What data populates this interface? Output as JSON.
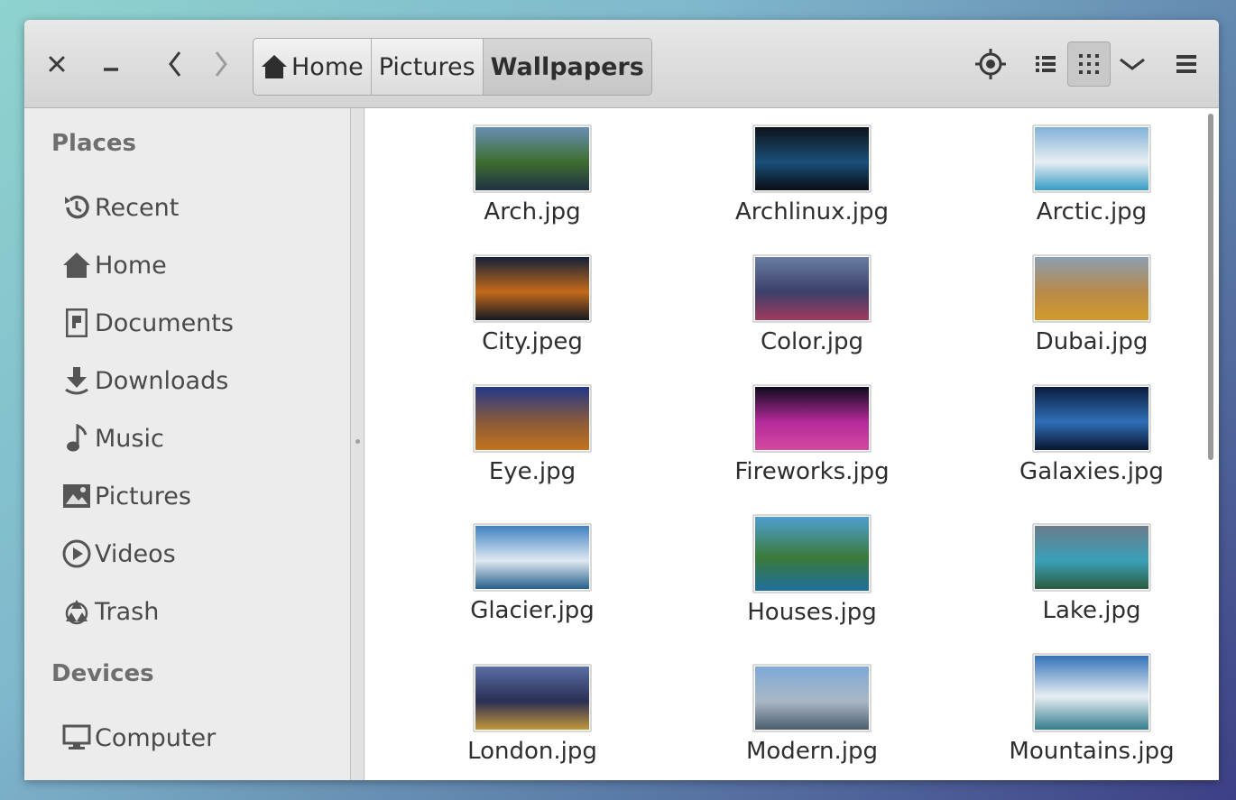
{
  "window": {
    "controls": {
      "close_icon": "close-icon",
      "minimize_icon": "minimize-icon"
    },
    "nav": {
      "back_icon": "chevron-left-icon",
      "forward_icon": "chevron-right-icon"
    },
    "breadcrumbs": [
      {
        "label": "Home",
        "icon": "home-icon"
      },
      {
        "label": "Pictures"
      },
      {
        "label": "Wallpapers",
        "active": true
      }
    ],
    "toolbar": {
      "location_icon": "crosshair-icon",
      "list_view_icon": "list-view-icon",
      "grid_view_icon": "grid-view-icon",
      "view_options_icon": "chevron-down-icon",
      "menu_icon": "hamburger-menu-icon"
    }
  },
  "sidebar": {
    "places_title": "Places",
    "places": [
      {
        "label": "Recent",
        "icon": "recent-icon"
      },
      {
        "label": "Home",
        "icon": "home-icon"
      },
      {
        "label": "Documents",
        "icon": "document-icon"
      },
      {
        "label": "Downloads",
        "icon": "download-icon"
      },
      {
        "label": "Music",
        "icon": "music-note-icon"
      },
      {
        "label": "Pictures",
        "icon": "picture-icon"
      },
      {
        "label": "Videos",
        "icon": "play-icon"
      },
      {
        "label": "Trash",
        "icon": "recycle-icon"
      }
    ],
    "devices_title": "Devices",
    "devices": [
      {
        "label": "Computer",
        "icon": "computer-icon"
      }
    ]
  },
  "files": [
    {
      "name": "Arch.jpg",
      "colors": [
        "#6a8fb8",
        "#3d6e2f",
        "#1e2f44"
      ]
    },
    {
      "name": "Archlinux.jpg",
      "colors": [
        "#0d1117",
        "#1a4f7a",
        "#0a0d12"
      ]
    },
    {
      "name": "Arctic.jpg",
      "colors": [
        "#7fb1d8",
        "#e8eef2",
        "#2f9ac3"
      ]
    },
    {
      "name": "City.jpeg",
      "colors": [
        "#0f1e3a",
        "#c46a1a",
        "#101622"
      ]
    },
    {
      "name": "Color.jpg",
      "colors": [
        "#6b7fa3",
        "#3b3f6a",
        "#a33b5e"
      ]
    },
    {
      "name": "Dubai.jpg",
      "colors": [
        "#8a9fb2",
        "#b78a4a",
        "#d49b2a"
      ]
    },
    {
      "name": "Eye.jpg",
      "colors": [
        "#20378a",
        "#8a5a3a",
        "#c4741c"
      ]
    },
    {
      "name": "Fireworks.jpg",
      "colors": [
        "#0a0a1a",
        "#b42a9a",
        "#d24aa0"
      ]
    },
    {
      "name": "Galaxies.jpg",
      "colors": [
        "#0a1a3a",
        "#2f6fb8",
        "#08132a"
      ]
    },
    {
      "name": "Glacier.jpg",
      "colors": [
        "#3c7fc0",
        "#dfe9f1",
        "#1f5a8a"
      ]
    },
    {
      "name": "Houses.jpg",
      "colors": [
        "#4f9fd4",
        "#3a7a3a",
        "#1f6ea0"
      ]
    },
    {
      "name": "Lake.jpg",
      "colors": [
        "#6c7a8a",
        "#3aa0b8",
        "#2b5a3a"
      ]
    },
    {
      "name": "London.jpg",
      "colors": [
        "#5a6fa8",
        "#2b2f54",
        "#c79a3a"
      ]
    },
    {
      "name": "Modern.jpg",
      "colors": [
        "#7ea8d8",
        "#a9b7c6",
        "#4a5a6a"
      ]
    },
    {
      "name": "Mountains.jpg",
      "colors": [
        "#2f6fb8",
        "#e8eef3",
        "#2e7a8a"
      ]
    }
  ]
}
